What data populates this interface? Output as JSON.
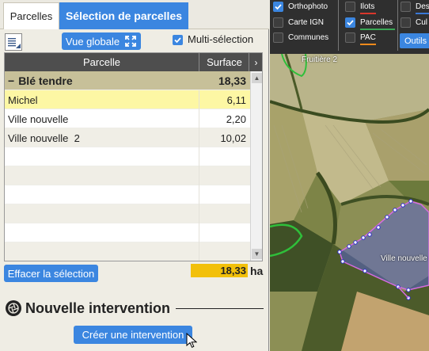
{
  "tabs": [
    {
      "label": "Parcelles",
      "active": false
    },
    {
      "label": "Sélection de parcelles",
      "active": true
    }
  ],
  "toolbar": {
    "vue_globale": "Vue globale",
    "multi_selection": "Multi-sélection",
    "multi_selection_checked": true
  },
  "grid": {
    "columns": [
      "Parcelle",
      "Surface"
    ],
    "group": {
      "label": "Blé tendre",
      "surface": "18,33",
      "collapse_symbol": "−"
    },
    "rows": [
      {
        "label": "Michel",
        "surface": "6,11",
        "selected": true
      },
      {
        "label": "Ville nouvelle",
        "surface": "2,20",
        "selected": false
      },
      {
        "label": "Ville nouvelle  2",
        "surface": "10,02",
        "selected": false
      }
    ]
  },
  "footer": {
    "effacer": "Effacer la sélection",
    "total": "18,33",
    "unit": "ha"
  },
  "intervention": {
    "title": "Nouvelle intervention",
    "create_button": "Créer une intervention"
  },
  "map_layers": {
    "base": [
      {
        "label": "Orthophoto",
        "checked": true
      },
      {
        "label": "Carte IGN",
        "checked": false
      },
      {
        "label": "Communes",
        "checked": false
      }
    ],
    "overlays": [
      {
        "label": "Ilots",
        "checked": false,
        "color": "#d9372b"
      },
      {
        "label": "Parcelles",
        "checked": true,
        "color": "#3aa856"
      },
      {
        "label": "PAC",
        "checked": false,
        "color": "#f08a1c"
      }
    ],
    "extra": [
      "Des",
      "Cul"
    ],
    "outils": "Outils"
  },
  "map_labels": {
    "top": "Fruitière 2",
    "field": "Ville nouvelle"
  },
  "colors": {
    "accent": "#3b86e0",
    "group_row": "#c7c099",
    "selected_row": "#fdf7a4",
    "total": "#f2c00a",
    "parcel_outline": "#d66be0"
  }
}
